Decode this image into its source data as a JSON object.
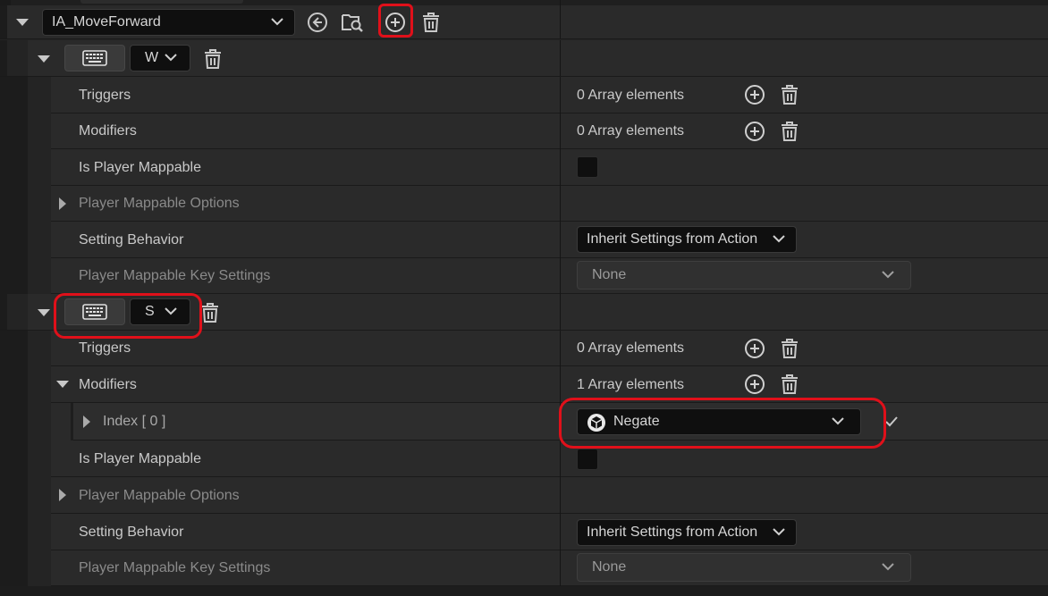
{
  "action": {
    "name": "IA_MoveForward",
    "toolbar_icons": [
      "back-arrow-icon",
      "browse-folder-icon",
      "add-icon",
      "delete-icon"
    ]
  },
  "mappings": [
    {
      "key": "W",
      "rows": {
        "triggers_label": "Triggers",
        "triggers_value": "0 Array elements",
        "modifiers_label": "Modifiers",
        "modifiers_value": "0 Array elements",
        "mappable_label": "Is Player Mappable",
        "options_label": "Player Mappable Options",
        "setting_label": "Setting Behavior",
        "setting_value": "Inherit Settings from Action",
        "key_settings_label": "Player Mappable Key Settings",
        "key_settings_value": "None"
      }
    },
    {
      "key": "S",
      "rows": {
        "triggers_label": "Triggers",
        "triggers_value": "0 Array elements",
        "modifiers_label": "Modifiers",
        "modifiers_value": "1 Array elements",
        "index_label": "Index [ 0 ]",
        "index_value": "Negate",
        "mappable_label": "Is Player Mappable",
        "options_label": "Player Mappable Options",
        "setting_label": "Setting Behavior",
        "setting_value": "Inherit Settings from Action",
        "key_settings_label": "Player Mappable Key Settings",
        "key_settings_value": "None"
      }
    }
  ],
  "colors": {
    "highlight": "#e0101a",
    "panel": "#2a2a2a",
    "input": "#0f0f0f"
  }
}
